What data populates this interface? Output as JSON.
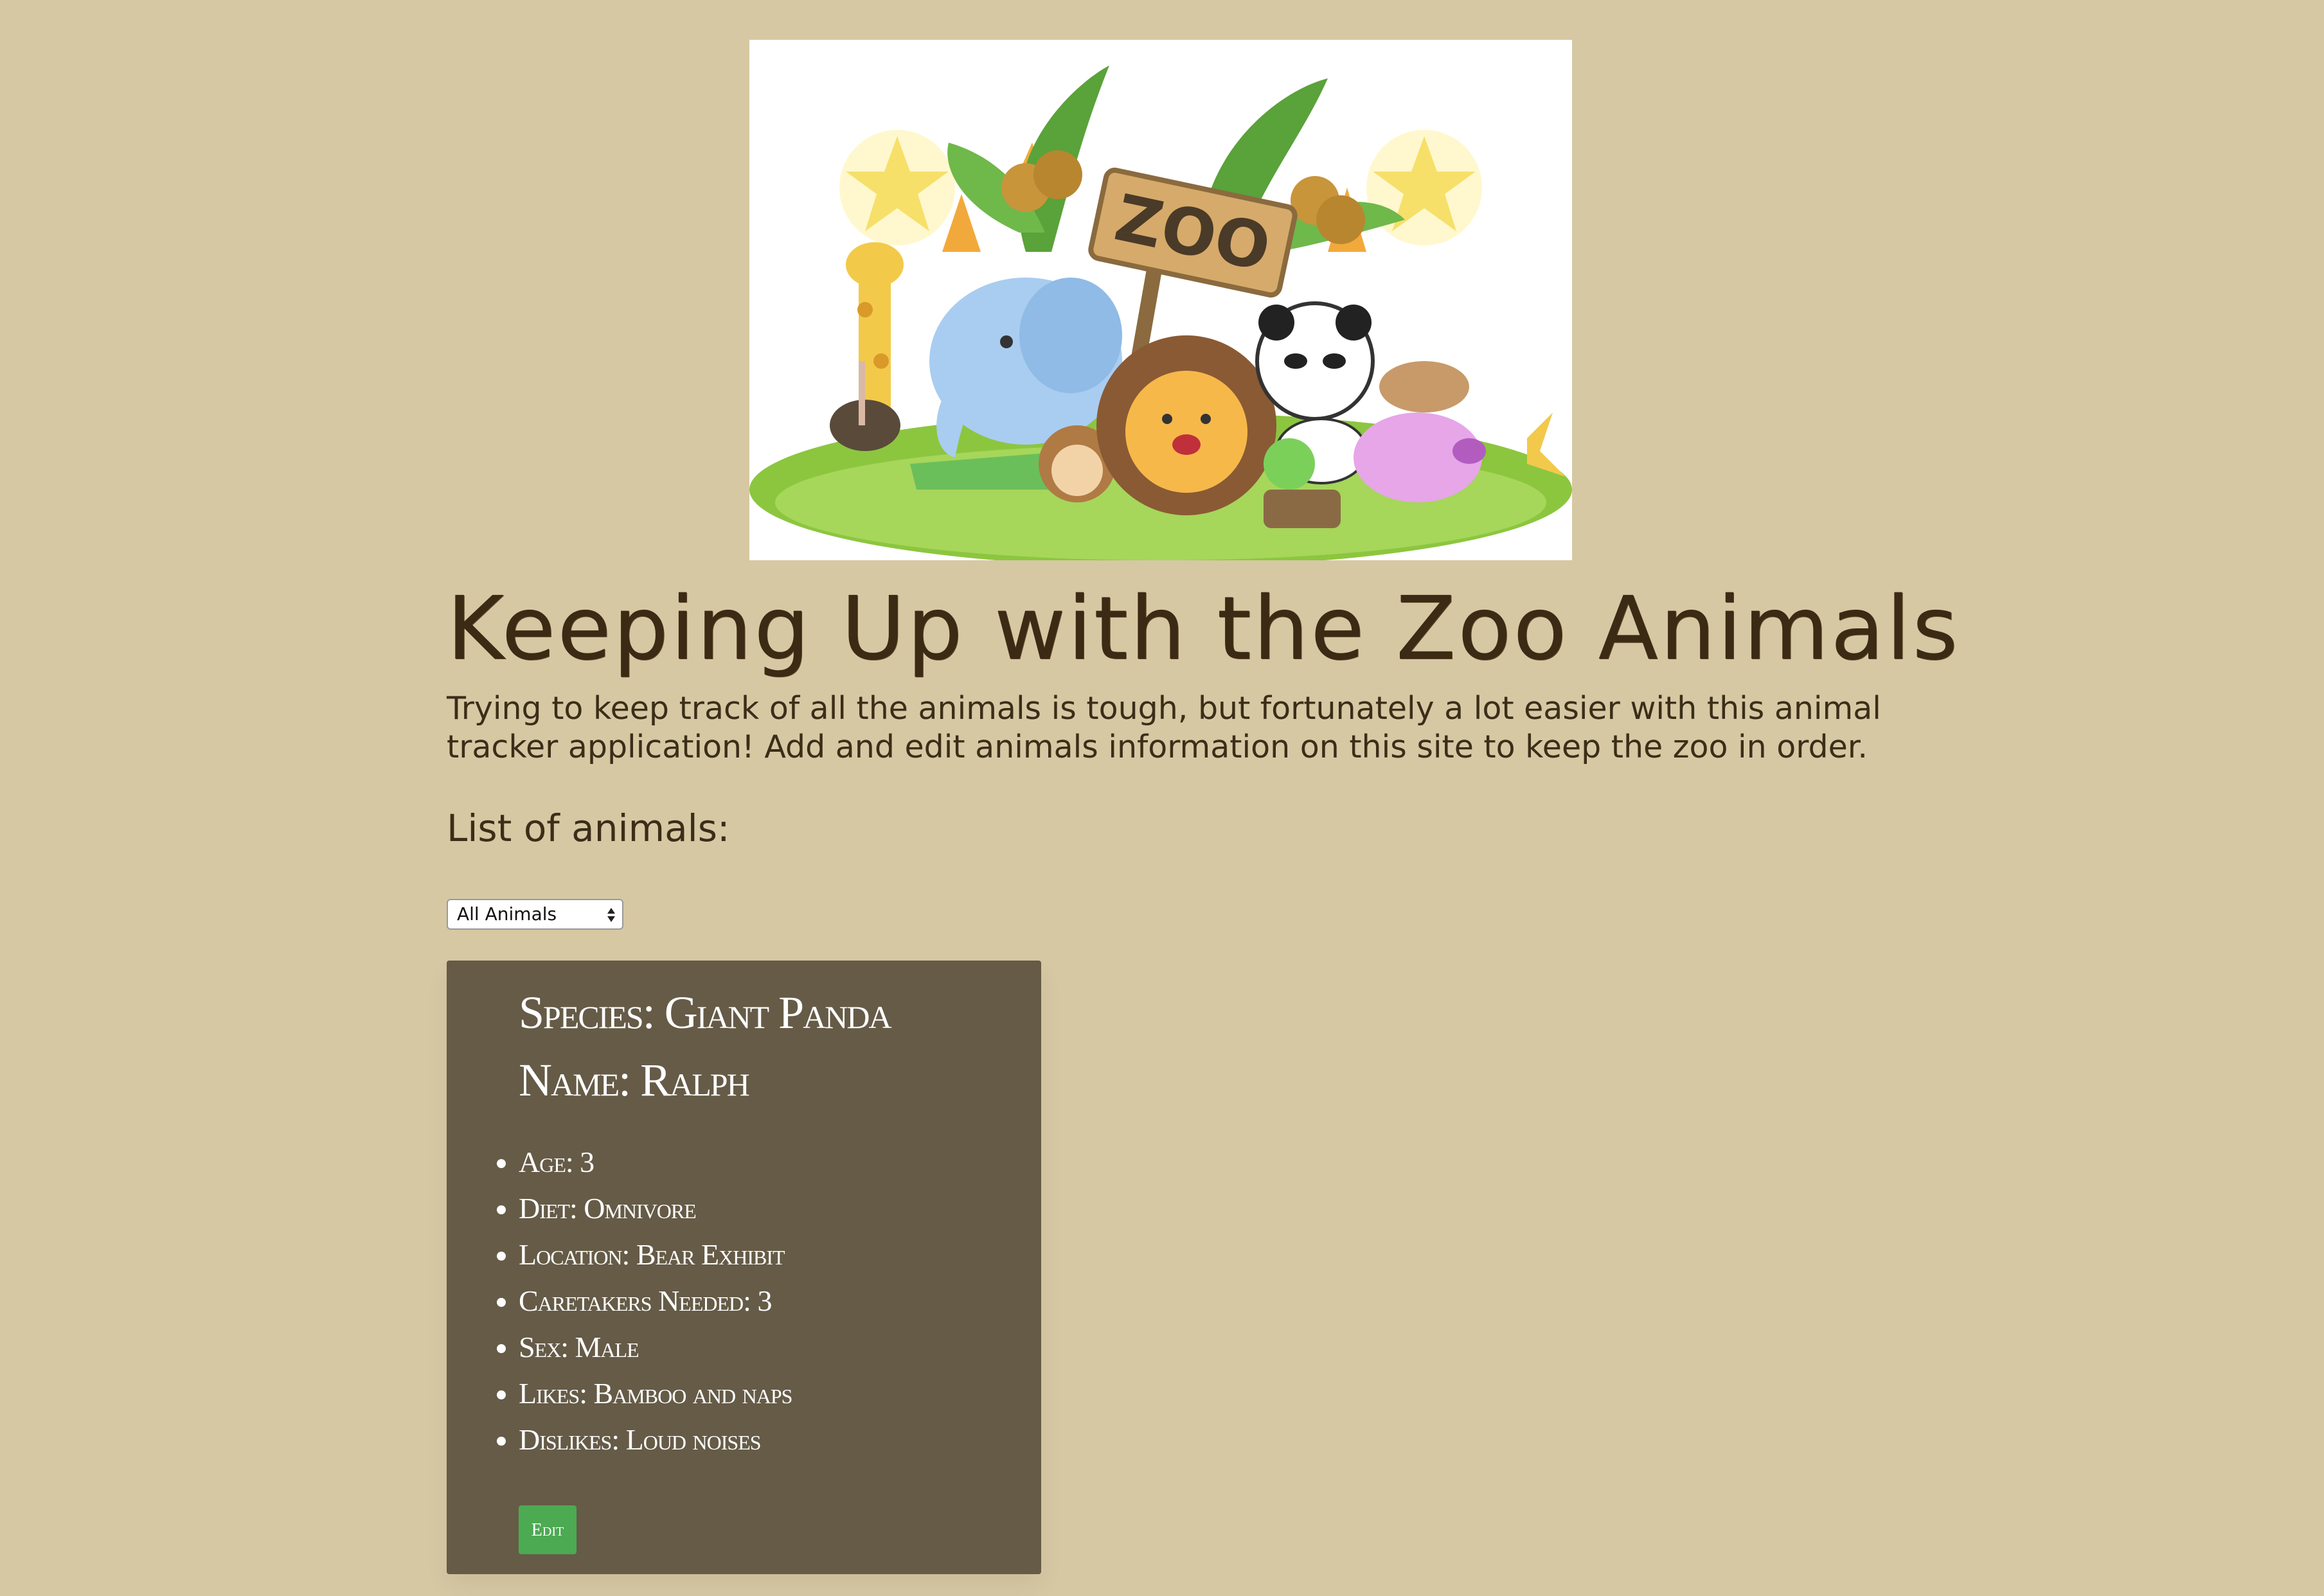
{
  "header": {
    "logo_text": "ZOO",
    "title": "Keeping Up with the Zoo Animals",
    "intro": "Trying to keep track of all the animals is tough, but fortunately a lot easier with this animal tracker application! Add and edit animals information on this site to keep the zoo in order."
  },
  "list": {
    "heading": "List of animals:",
    "filter": {
      "selected": "All Animals"
    }
  },
  "animal": {
    "species_label": "Species:",
    "species": "Giant Panda",
    "name_label": "Name:",
    "name": "Ralph",
    "details": [
      {
        "label": "Age:",
        "value": "3"
      },
      {
        "label": "Diet:",
        "value": "Omnivore"
      },
      {
        "label": "Location:",
        "value": "Bear Exhibit"
      },
      {
        "label": "Caretakers Needed:",
        "value": "3"
      },
      {
        "label": "Sex:",
        "value": "Male"
      },
      {
        "label": "Likes:",
        "value": "Bamboo and naps"
      },
      {
        "label": "Dislikes:",
        "value": "Loud noises"
      }
    ],
    "edit_label": "Edit"
  },
  "colors": {
    "page_background": "#d6c8a3",
    "card_background": "#655b47",
    "edit_button": "#4caa52",
    "title_text": "#3b2a14"
  }
}
